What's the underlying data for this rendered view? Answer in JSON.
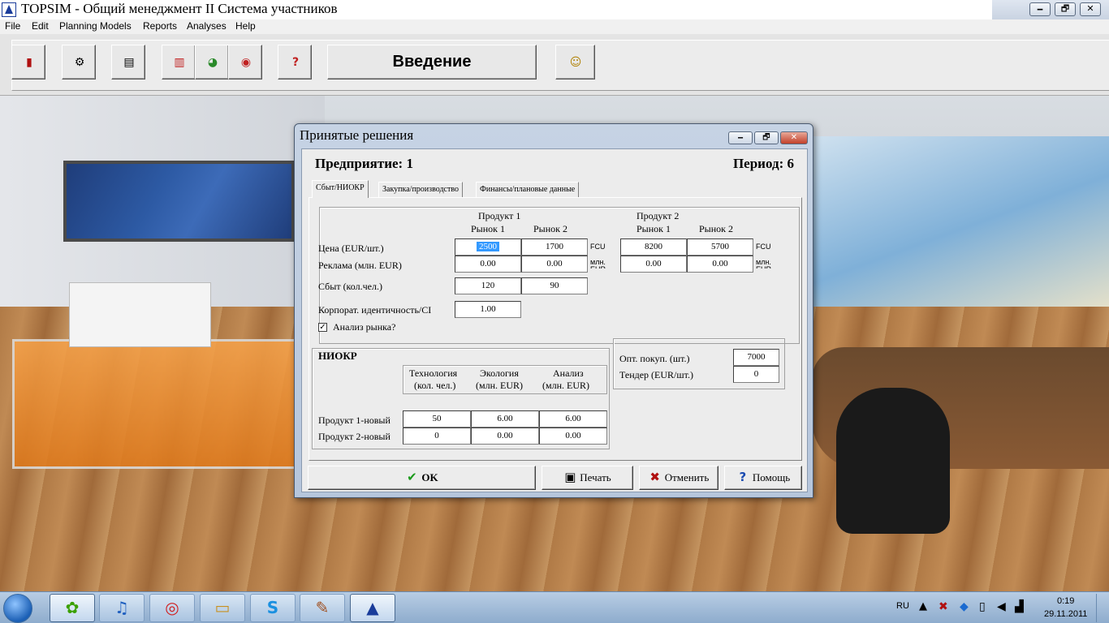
{
  "window": {
    "title": "TOPSIM - Общий менеджмент II Система участников",
    "title_prefix": "T(",
    "minimize_glyph": "🗕",
    "maximize_glyph": "🗗",
    "close_glyph": "✕"
  },
  "menu": [
    "File",
    "Edit",
    "Planning Models",
    "Reports",
    "Analyses",
    "Help"
  ],
  "toolbar": {
    "buttons": [
      {
        "icon": "exit-icon",
        "glyph": "▮"
      },
      {
        "icon": "document-gear-icon",
        "glyph": "⚙"
      },
      {
        "icon": "documents-icon",
        "glyph": "▤"
      },
      {
        "icon": "bar-chart-icon",
        "glyph": "▥"
      },
      {
        "icon": "pie-chart-icon",
        "glyph": "◕"
      },
      {
        "icon": "analysis-icon",
        "glyph": "◉"
      },
      {
        "icon": "help-icon",
        "glyph": "?"
      },
      {
        "icon": "teacher-icon",
        "glyph": "☺"
      }
    ],
    "intro_label": "Введение"
  },
  "dialog": {
    "title": "Принятые решения",
    "enterprise": "Предприятие: 1",
    "period": "Период: 6",
    "tabs": [
      "Сбыт/НИОКР",
      "Закупка/производство",
      "Финансы/плановые данные"
    ],
    "sales": {
      "product1_header": "Продукт 1",
      "product2_header": "Продукт 2",
      "market1": "Рынок 1",
      "market2": "Рынок 2",
      "price_label": "Цена (EUR/шт.)",
      "ad_label": "Реклама (млн. EUR)",
      "salesforce_label": "Сбыт (кол.чел.)",
      "ci_label": "Корпорат. идентичность/CI",
      "market_research_label": "Анализ рынка?",
      "market_research_checked": "✓",
      "unit_fcu": "FCU",
      "unit_mln_eur": "млн. EUR",
      "p1_price": [
        "2500",
        "1700"
      ],
      "p1_ad": [
        "0.00",
        "0.00"
      ],
      "p2_price": [
        "8200",
        "5700"
      ],
      "p2_ad": [
        "0.00",
        "0.00"
      ],
      "salesforce": [
        "120",
        "90"
      ],
      "ci": "1.00"
    },
    "rnd": {
      "title": "НИОКР",
      "col1": [
        "Технология",
        "(кол. чел.)"
      ],
      "col2": [
        "Экология",
        "(млн. EUR)"
      ],
      "col3": [
        "Анализ",
        "(млн. EUR)"
      ],
      "rows": [
        {
          "label": "Продукт 1-новый",
          "values": [
            "50",
            "6.00",
            "6.00"
          ]
        },
        {
          "label": "Продукт 2-новый",
          "values": [
            "0",
            "0.00",
            "0.00"
          ]
        }
      ]
    },
    "purchase": {
      "opt_label": "Опт. покуп. (шт.)",
      "opt_value": "7000",
      "tender_label": "Тендер (EUR/шт.)",
      "tender_value": "0"
    },
    "buttons": {
      "ok": "OK",
      "print": "Печать",
      "cancel": "Отменить",
      "help": "Помощь"
    }
  },
  "taskbar": {
    "items": [
      {
        "icon": "icq-icon",
        "glyph": "✿"
      },
      {
        "icon": "itunes-icon",
        "glyph": "♫"
      },
      {
        "icon": "chrome-icon",
        "glyph": "◎"
      },
      {
        "icon": "explorer-icon",
        "glyph": "▭"
      },
      {
        "icon": "skype-icon",
        "glyph": "S"
      },
      {
        "icon": "paint-icon",
        "glyph": "✎"
      },
      {
        "icon": "topsim-icon",
        "glyph": "▲"
      }
    ],
    "language": "RU",
    "time": "0:19",
    "date": "29.11.2011"
  }
}
